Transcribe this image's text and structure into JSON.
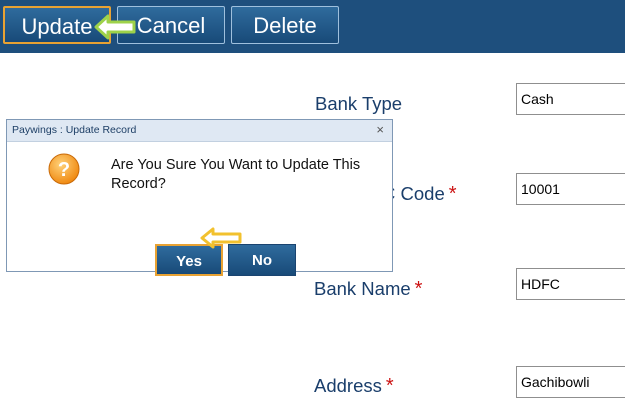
{
  "toolbar": {
    "update_label": "Update",
    "cancel_label": "Cancel",
    "delete_label": "Delete"
  },
  "form": {
    "bank_type_label": "Bank Type",
    "bank_type_value": "Cash",
    "ifsc_code_label": "C Code",
    "ifsc_code_value": "10001",
    "bank_name_label": "Bank Name",
    "bank_name_value": "HDFC",
    "address_label": "Address",
    "address_value": "Gachibowli",
    "required_marker": "*"
  },
  "dialog": {
    "title": "Paywings : Update Record",
    "close_glyph": "×",
    "message": "Are You Sure You Want to Update This Record?",
    "yes_label": "Yes",
    "no_label": "No",
    "icon": "question-icon"
  },
  "colors": {
    "button_blue": "#1e4f7d",
    "highlight_orange": "#e8a233",
    "arrow_green": "#9ed24a",
    "arrow_yellow": "#f2c12e",
    "label_blue": "#1a3e6b",
    "required_red": "#cc1111"
  }
}
